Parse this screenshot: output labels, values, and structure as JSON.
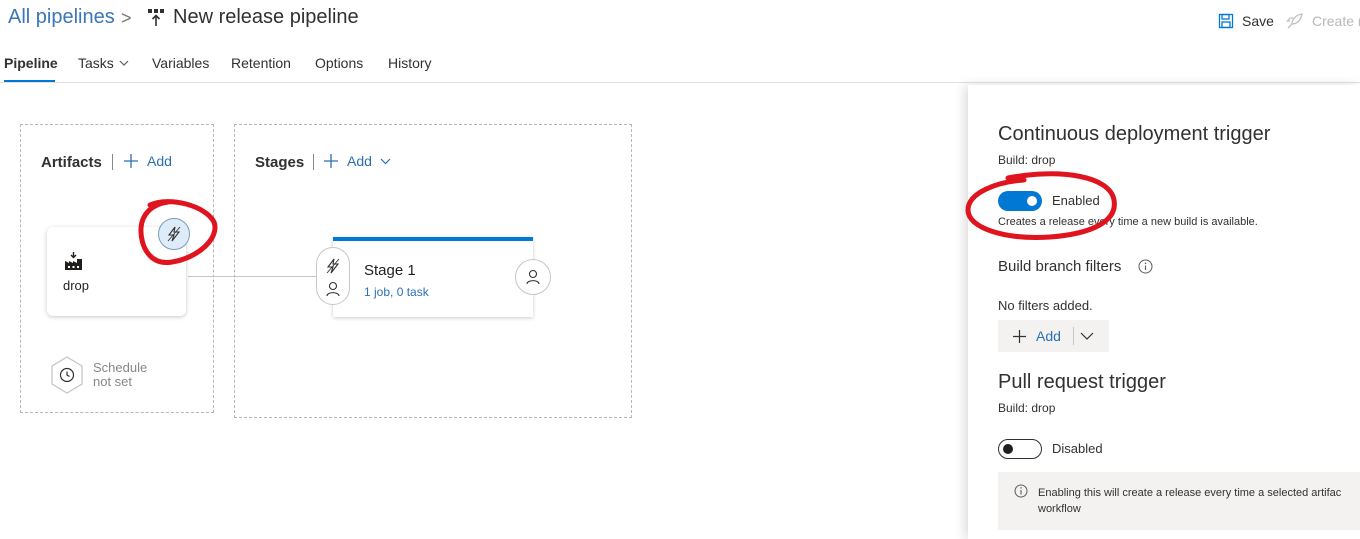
{
  "header": {
    "breadcrumb_root": "All pipelines",
    "breadcrumb_sep": ">",
    "title": "New release pipeline",
    "save_label": "Save",
    "create_label": "Create r"
  },
  "tabs": [
    {
      "label": "Pipeline",
      "active": true
    },
    {
      "label": "Tasks"
    },
    {
      "label": "Variables"
    },
    {
      "label": "Retention"
    },
    {
      "label": "Options"
    },
    {
      "label": "History"
    }
  ],
  "artifacts": {
    "title": "Artifacts",
    "add_label": "Add",
    "card_name": "drop",
    "schedule_line1": "Schedule",
    "schedule_line2": "not set"
  },
  "stages": {
    "title": "Stages",
    "add_label": "Add",
    "stage_name": "Stage 1",
    "stage_detail": "1 job, 0 task"
  },
  "panel": {
    "cd_title": "Continuous deployment trigger",
    "cd_source": "Build: drop",
    "cd_state": "Enabled",
    "cd_desc": "Creates a release every time a new build is available.",
    "filters_title": "Build branch filters",
    "filters_empty": "No filters added.",
    "filters_add": "Add",
    "pr_title": "Pull request trigger",
    "pr_source": "Build: drop",
    "pr_state": "Disabled",
    "pr_info_line1": "Enabling this will create a release every time a selected artifac",
    "pr_info_line2": "workflow"
  },
  "colors": {
    "accent": "#0078d4",
    "link": "#2c6fb6",
    "annotation": "#e0141e"
  }
}
